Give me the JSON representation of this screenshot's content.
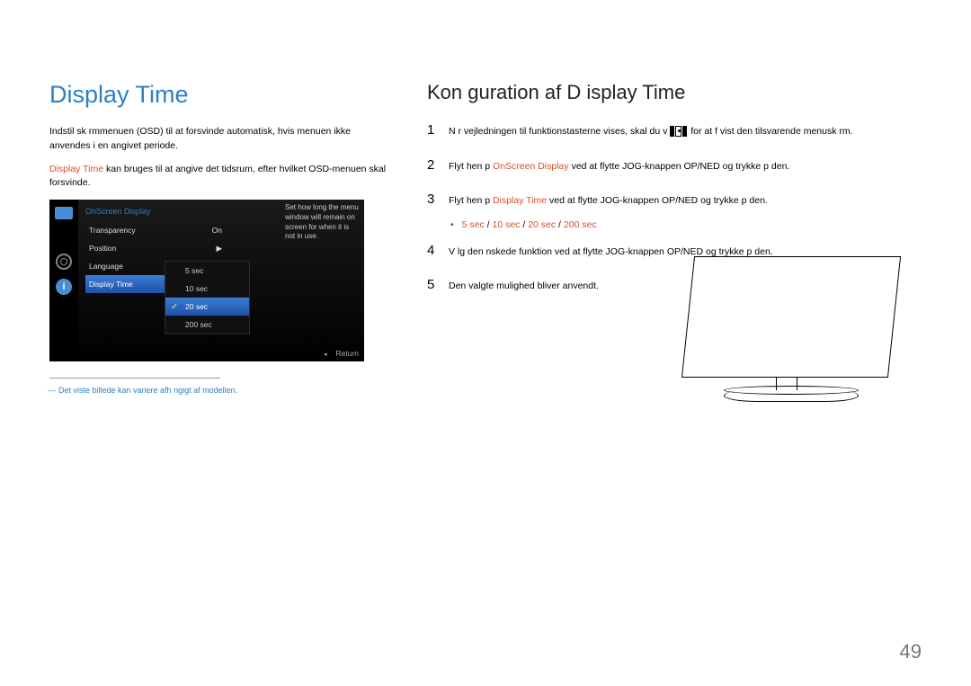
{
  "left": {
    "title": "Display Time",
    "intro1": "Indstil sk rmmenuen (OSD) til at forsvinde automatisk, hvis menuen ikke anvendes i en angivet periode.",
    "intro2_em": "Display Time",
    "intro2_rest": " kan bruges til at angive det tidsrum, efter hvilket OSD-menuen skal forsvinde.",
    "note": "Det viste billede kan variere afh ngigt af modellen."
  },
  "osd": {
    "header": "OnScreen Display",
    "rows": [
      {
        "label": "Transparency",
        "value": "On"
      },
      {
        "label": "Position",
        "value": "▶"
      },
      {
        "label": "Language",
        "value": ""
      },
      {
        "label": "Display Time",
        "value": ""
      }
    ],
    "submenu": [
      "5 sec",
      "10 sec",
      "20 sec",
      "200 sec"
    ],
    "submenu_selected_index": 2,
    "desc": "Set how long the menu window will remain on screen for when it is not in use.",
    "return": "Return"
  },
  "right": {
    "title": "Kon guration af D isplay Time",
    "step1": "N r vejledningen til funktionstasterne vises, skal du v",
    "step1b": "for at f  vist den tilsvarende menusk rm.",
    "step2a": "Flyt hen p  ",
    "step2_em": "OnScreen Display",
    "step2b": " ved at flytte JOG-knappen OP/NED og trykke p  den.",
    "step3a": "Flyt hen p  ",
    "step3_em": "Display Time",
    "step3b": " ved at flytte JOG-knappen OP/NED og trykke p  den.",
    "options": [
      "5 sec",
      "10 sec",
      "20 sec",
      "200 sec"
    ],
    "step4": "V lg den  nskede funktion ved at flytte JOG-knappen OP/NED og trykke p  den.",
    "step5": "Den valgte mulighed bliver anvendt."
  },
  "pagenum": "49"
}
